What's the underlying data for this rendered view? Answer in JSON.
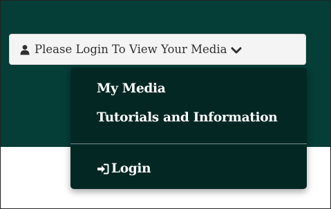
{
  "header": {
    "login_button": {
      "label": "Please Login To View Your Media",
      "icon": "user-icon",
      "caret_icon": "chevron-down-icon"
    }
  },
  "dropdown": {
    "items": [
      {
        "label": "My Media"
      },
      {
        "label": "Tutorials and Information"
      }
    ],
    "login": {
      "label": "Login",
      "icon": "sign-in-icon"
    }
  },
  "colors": {
    "header_background": "#053d37",
    "dropdown_background": "#032824",
    "button_background": "#f4f4f4",
    "page_background": "#ffffff"
  }
}
